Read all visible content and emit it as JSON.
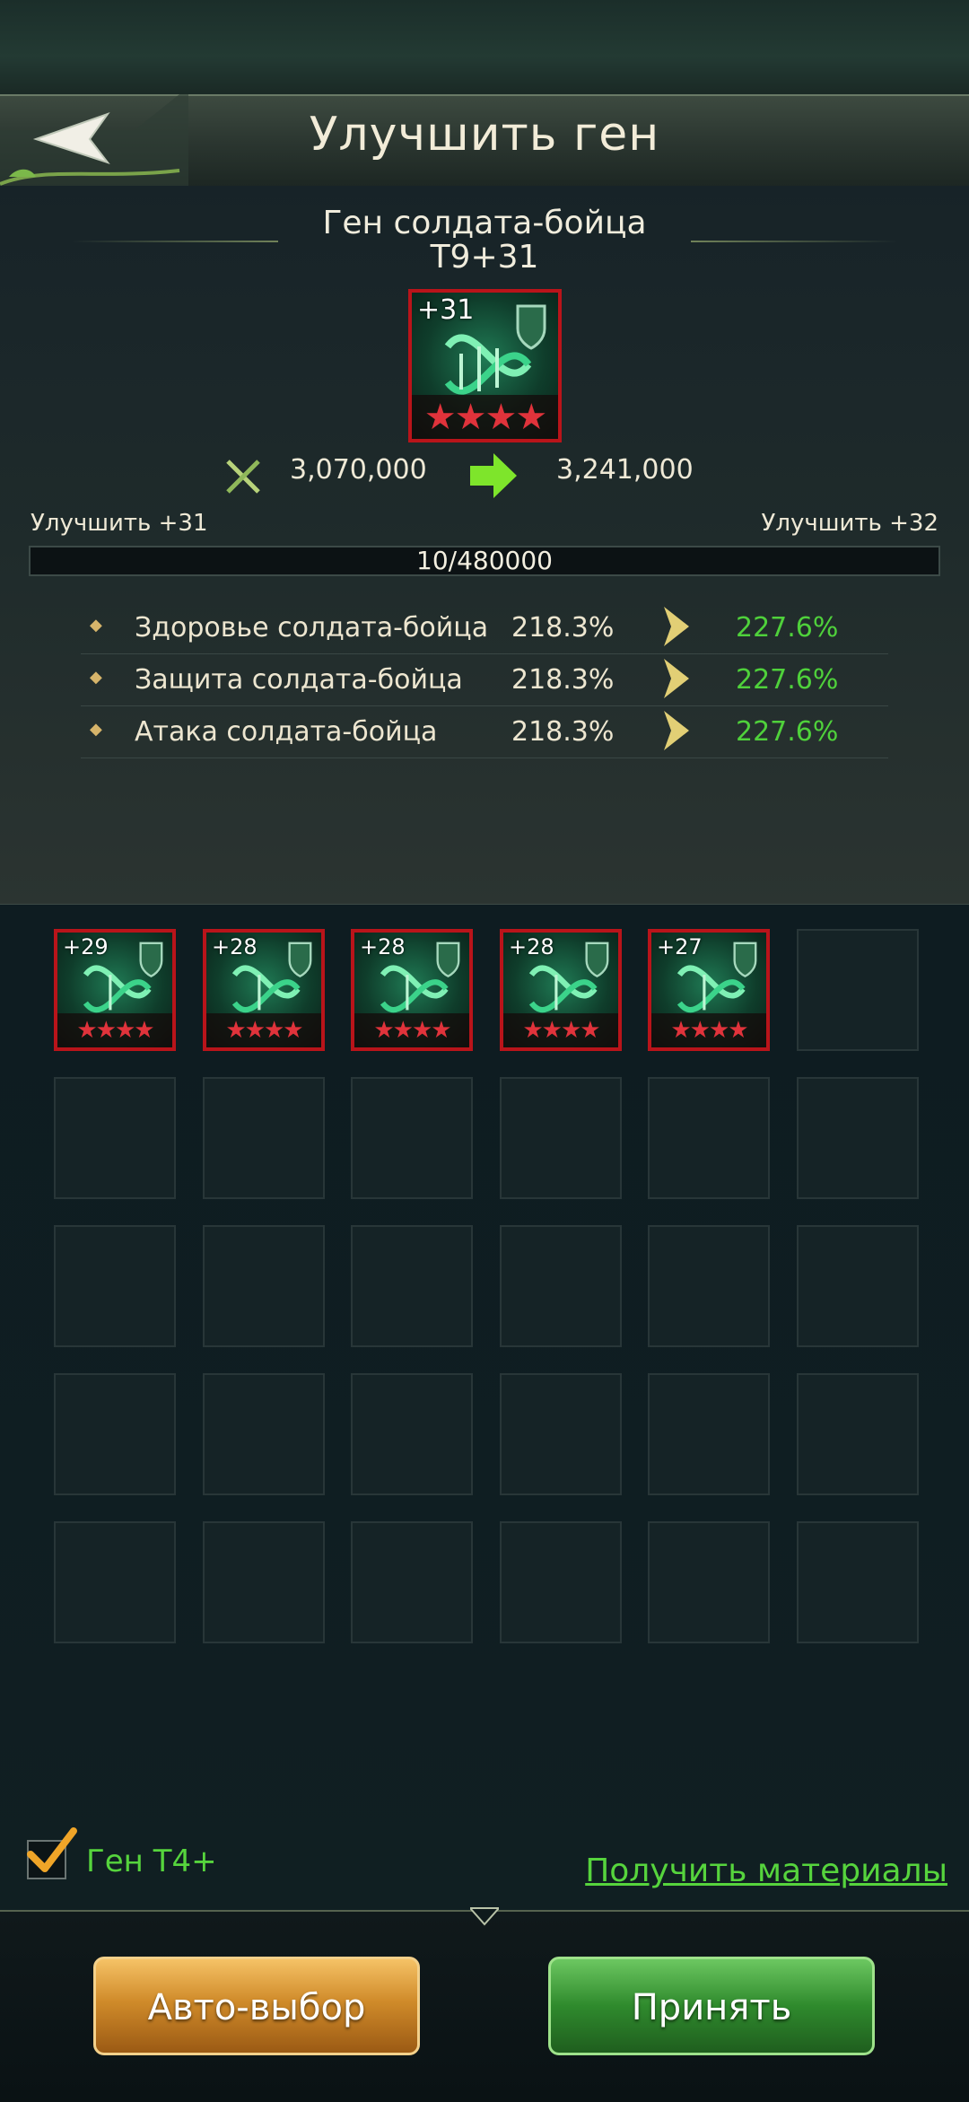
{
  "header": {
    "title": "Улучшить ген",
    "back_icon": "back-arrow-icon"
  },
  "gene": {
    "name": "Ген солдата-бойца",
    "tier": "T9+31",
    "level_badge": "+31",
    "stars": "★★★★",
    "power_current": "3,070,000",
    "power_next": "3,241,000"
  },
  "progress": {
    "label_current": "Улучшить +31",
    "label_next": "Улучшить +32",
    "text": "10/480000",
    "fraction": 2.08e-05
  },
  "stats": [
    {
      "name": "Здоровье солдата-бойца",
      "current": "218.3%",
      "next": "227.6%"
    },
    {
      "name": "Защита солдата-бойца",
      "current": "218.3%",
      "next": "227.6%"
    },
    {
      "name": "Атака солдата-бойца",
      "current": "218.3%",
      "next": "227.6%"
    }
  ],
  "materials": [
    {
      "level": "+29",
      "stars": "★★★★"
    },
    {
      "level": "+28",
      "stars": "★★★★"
    },
    {
      "level": "+28",
      "stars": "★★★★"
    },
    {
      "level": "+28",
      "stars": "★★★★"
    },
    {
      "level": "+27",
      "stars": "★★★★"
    }
  ],
  "footer": {
    "filter_label": "Ген T4+",
    "filter_checked": true,
    "get_materials": "Получить материалы",
    "auto_select": "Авто-выбор",
    "accept": "Принять"
  },
  "colors": {
    "accent_green": "#4fd13b",
    "card_border_red": "#b9141a",
    "button_gold": "#d08b2a",
    "button_green": "#2f8a2d"
  }
}
